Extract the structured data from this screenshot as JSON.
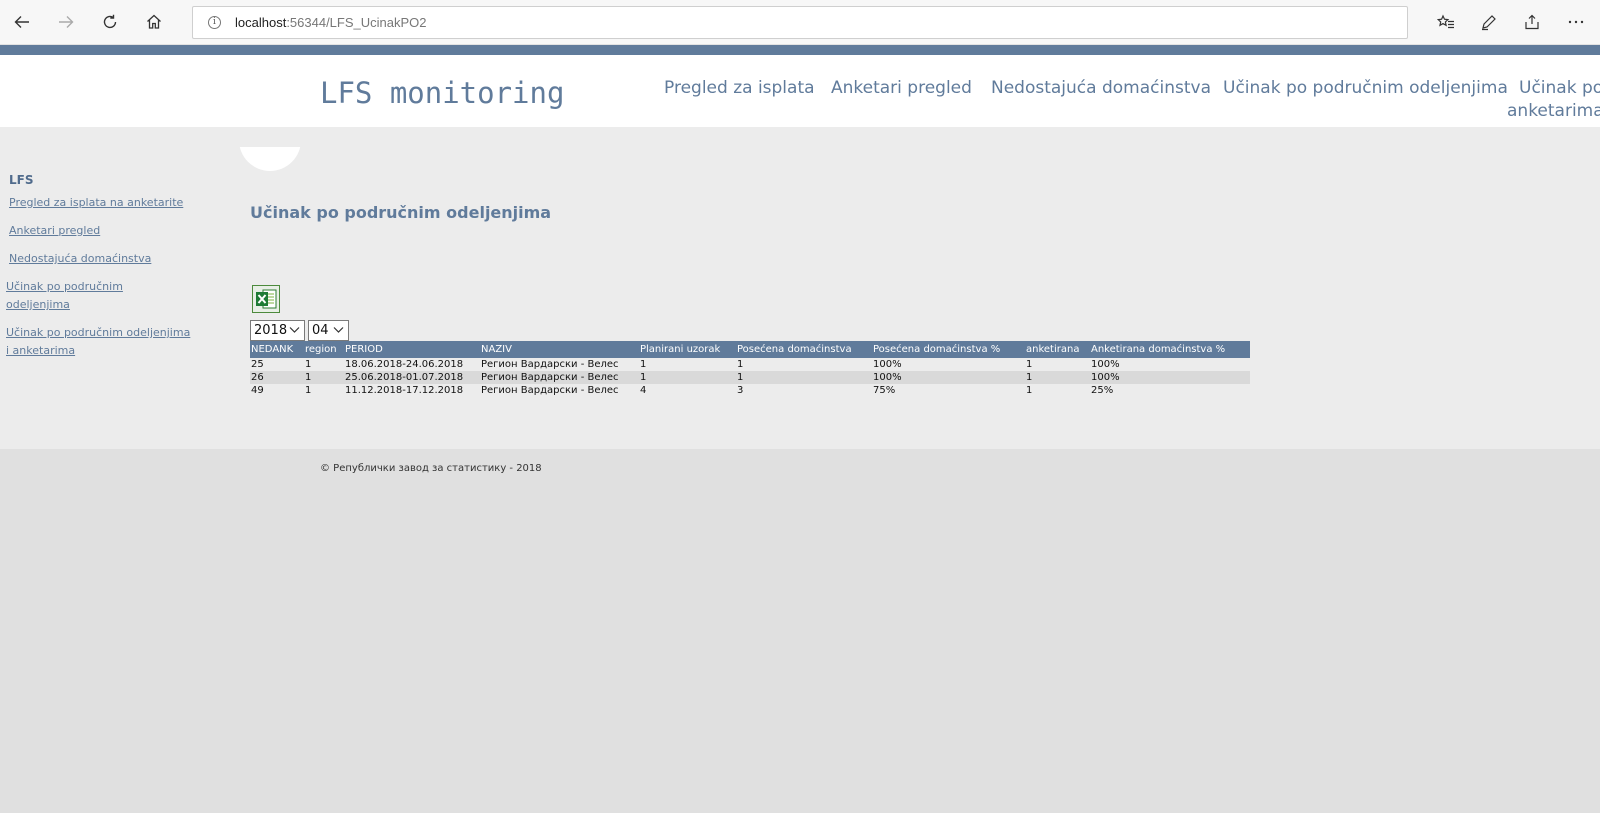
{
  "browser": {
    "url_host": "localhost",
    "url_rest": ":56344/LFS_UcinakPO2",
    "info_glyph": "i",
    "icons": [
      "back-icon",
      "forward-icon",
      "refresh-icon",
      "home-icon",
      "favorites-icon",
      "pen-icon",
      "share-icon",
      "more-icon"
    ]
  },
  "header": {
    "site_title": "LFS monitoring",
    "nav": [
      "Pregled za isplata",
      "Anketari pregled",
      "Nedostajuća domaćinstva",
      "Učinak po područnim odeljenjima",
      "Učinak po",
      "anketarima"
    ]
  },
  "sidebar": {
    "title": "LFS",
    "links": [
      "Pregled za isplata na anketarite ",
      "Anketari pregled",
      "Nedostajuća domaćinstva ",
      " Učinak po područnim",
      "odeljenjima",
      " Učinak po područnim odeljenjima",
      "i anketarima"
    ]
  },
  "main": {
    "title": "Učinak po područnim odeljenjima",
    "export_icon": "excel-icon",
    "year_select": "2018",
    "month_select": "04"
  },
  "table": {
    "headers": [
      "NEDANK",
      "region",
      "PERIOD",
      "NAZIV",
      "Planirani uzorak",
      "Posećena domaćinstva",
      "Posećena domaćinstva %",
      "anketirana",
      "Anketirana domaćinstva %"
    ],
    "rows": [
      [
        "25",
        "1",
        "18.06.2018-24.06.2018",
        "Регион Вардарски - Велес",
        "1",
        "1",
        "100%",
        "1",
        "100%"
      ],
      [
        "26",
        "1",
        "25.06.2018-01.07.2018",
        "Регион Вардарски - Велес",
        "1",
        "1",
        "100%",
        "1",
        "100%"
      ],
      [
        "49",
        "1",
        "11.12.2018-17.12.2018",
        "Регион Вардарски - Велес",
        "4",
        "3",
        "75%",
        "1",
        "25%"
      ]
    ]
  },
  "footer": {
    "text": "© Републички завод за статистику - 2018"
  },
  "colors": {
    "accent": "#607b9b",
    "header_bg": "#ffffff",
    "content_bg": "#ececec",
    "page_bg": "#e0e0e0",
    "table_alt_row": "#d9d9d9"
  }
}
